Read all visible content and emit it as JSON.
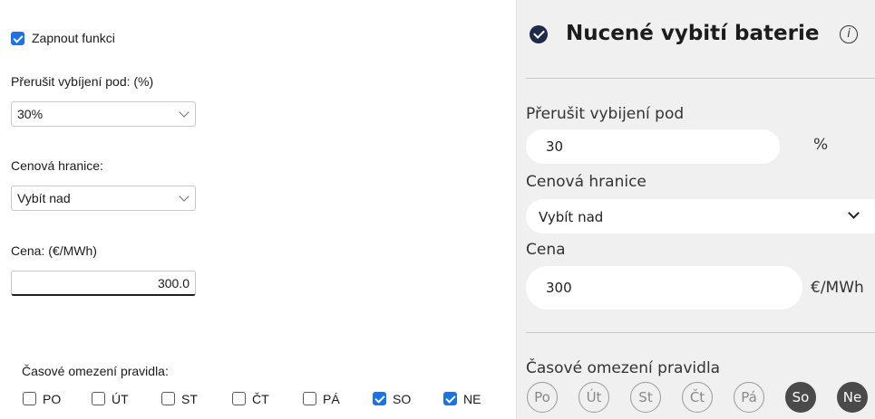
{
  "left": {
    "enable_label": "Zapnout funkci",
    "enable_checked": true,
    "stop_label": "Přerušit vybíjení pod: (%)",
    "stop_value": "30%",
    "price_limit_label": "Cenová hranice:",
    "price_limit_value": "Vybít nad",
    "price_label": "Cena: (€/MWh)",
    "price_value": "300.0",
    "time_label": "Časové omezení pravidla:",
    "days": [
      {
        "label": "PO",
        "checked": false
      },
      {
        "label": "ÚT",
        "checked": false
      },
      {
        "label": "ST",
        "checked": false
      },
      {
        "label": "ČT",
        "checked": false
      },
      {
        "label": "PÁ",
        "checked": false
      },
      {
        "label": "SO",
        "checked": true
      },
      {
        "label": "NE",
        "checked": true
      }
    ]
  },
  "right": {
    "title": "Nucené vybití baterie",
    "info_glyph": "i",
    "stop_label": "Přerušit vybijení pod",
    "stop_value": "30",
    "stop_unit": "%",
    "price_limit_label": "Cenová hranice",
    "price_limit_value": "Vybít nad",
    "price_label": "Cena",
    "price_value": "300",
    "price_unit": "€/MWh",
    "time_label": "Časové omezení pravidla",
    "days": [
      {
        "label": "Po",
        "active": false
      },
      {
        "label": "Út",
        "active": false
      },
      {
        "label": "St",
        "active": false
      },
      {
        "label": "Čt",
        "active": false
      },
      {
        "label": "Pá",
        "active": false
      },
      {
        "label": "So",
        "active": true
      },
      {
        "label": "Ne",
        "active": true
      }
    ]
  },
  "colors": {
    "accent_check": "#1a73e8",
    "title_check": "#1e2a4a",
    "active_chip": "#4a4a4a",
    "panel_bg": "#f0f0f0"
  }
}
